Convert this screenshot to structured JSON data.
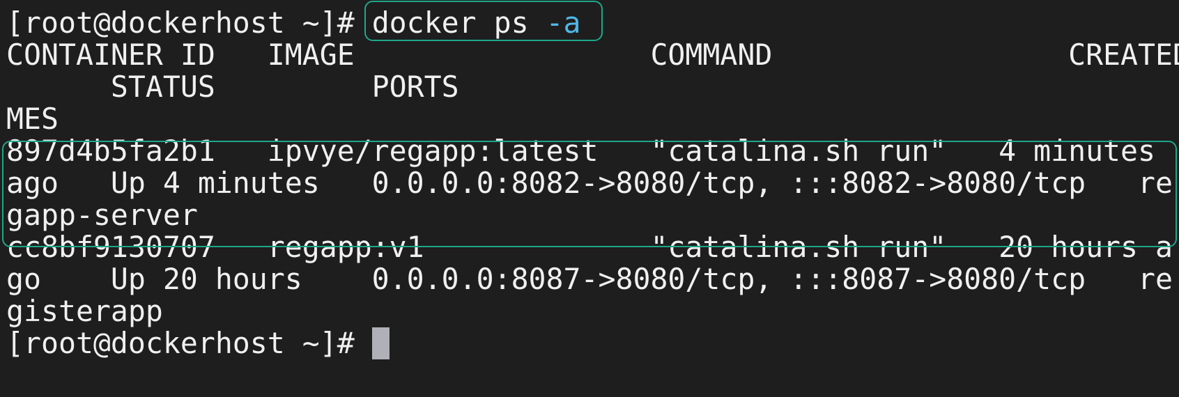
{
  "terminal": {
    "lines": [
      {
        "prompt": "[root@dockerhost ~]# ",
        "cmd": "docker ps ",
        "flag": "-a"
      },
      {
        "text": "CONTAINER ID   IMAGE                 COMMAND                 CREATED"
      },
      {
        "text": "      STATUS         PORTS                                          NA"
      },
      {
        "text": "MES"
      },
      {
        "text": "897d4b5fa2b1   ipvye/regapp:latest   \"catalina.sh run\"   4 minutes"
      },
      {
        "text": "ago   Up 4 minutes   0.0.0.0:8082->8080/tcp, :::8082->8080/tcp   re"
      },
      {
        "text": "gapp-server"
      },
      {
        "text": "cc8bf9130707   regapp:v1             \"catalina.sh run\"   20 hours a"
      },
      {
        "text": "go    Up 20 hours    0.0.0.0:8087->8080/tcp, :::8087->8080/tcp   re"
      },
      {
        "text": "gisterapp"
      },
      {
        "prompt": "[root@dockerhost ~]# "
      }
    ]
  },
  "colors": {
    "background": "#1e1e1e",
    "text": "#f0f0f0",
    "flag": "#4fb8e8",
    "highlight_border": "#1fa78a",
    "cursor": "#b0b0b8"
  }
}
